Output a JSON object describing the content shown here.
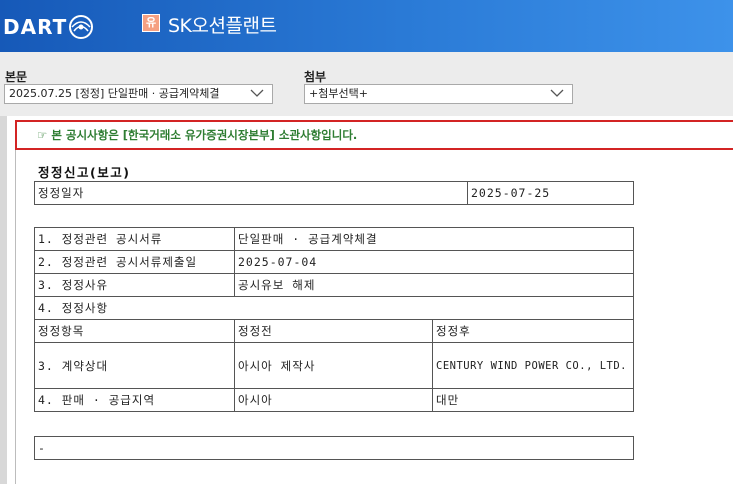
{
  "header": {
    "logo_text": "DART",
    "logo_icon": "dart-swirl-icon",
    "badge": "유",
    "company_name": "SK오션플랜트"
  },
  "selectors": {
    "main_label": "본문",
    "main_value": "2025.07.25 [정정] 단일판매 · 공급계약체결",
    "attach_label": "첨부",
    "attach_value": "+첨부선택+"
  },
  "notice": "☞ 본 공시사항은 [한국거래소 유가증권시장본부] 소관사항입니다.",
  "document": {
    "title": "정정신고(보고)",
    "date_table": {
      "label": "정정일자",
      "value": "2025-07-25"
    },
    "detail_table": {
      "rows": [
        [
          "1. 정정관련 공시서류",
          "단일판매 · 공급계약체결"
        ],
        [
          "2. 정정관련 공시서류제출일",
          "2025-07-04"
        ],
        [
          "3. 정정사유",
          "공시유보 해제"
        ]
      ],
      "section_header": "4. 정정사항",
      "columns": [
        "정정항목",
        "정정전",
        "정정후"
      ],
      "changes": [
        [
          "3. 계약상대",
          "아시아 제작사",
          "CENTURY WIND POWER CO., LTD."
        ],
        [
          "4. 판매 · 공급지역",
          "아시아",
          "대만"
        ]
      ]
    },
    "footer_cell": "-"
  },
  "colors": {
    "header_blue": "#1659b8",
    "notice_border": "#d32424",
    "notice_text": "#2e7d32"
  }
}
